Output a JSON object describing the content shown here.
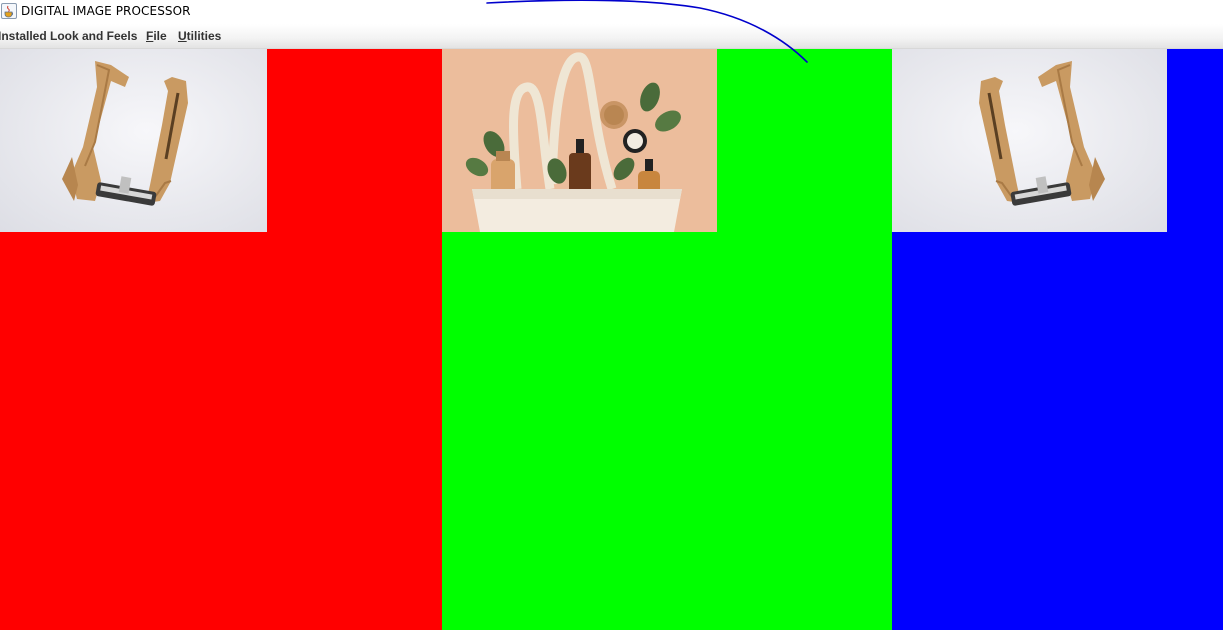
{
  "window": {
    "title": "DIGITAL IMAGE PROCESSOR",
    "icon": "java-cup-icon"
  },
  "menubar": {
    "items": [
      {
        "label": "Installed Look and Feels",
        "mnemonic": ""
      },
      {
        "label": "ile",
        "mnemonic": "F"
      },
      {
        "label": "tilities",
        "mnemonic": "U"
      }
    ]
  },
  "panels": [
    {
      "channel": "red",
      "color": "#ff0000",
      "image": "razor-packaging-image"
    },
    {
      "channel": "green",
      "color": "#00ff00",
      "image": "cosmetics-tote-bag-image"
    },
    {
      "channel": "blue",
      "color": "#0000ff",
      "image": "razor-packaging-image-mirrored"
    }
  ],
  "annotation": {
    "stroke_color": "#0000cc",
    "icon": "hand-drawn-stroke"
  }
}
